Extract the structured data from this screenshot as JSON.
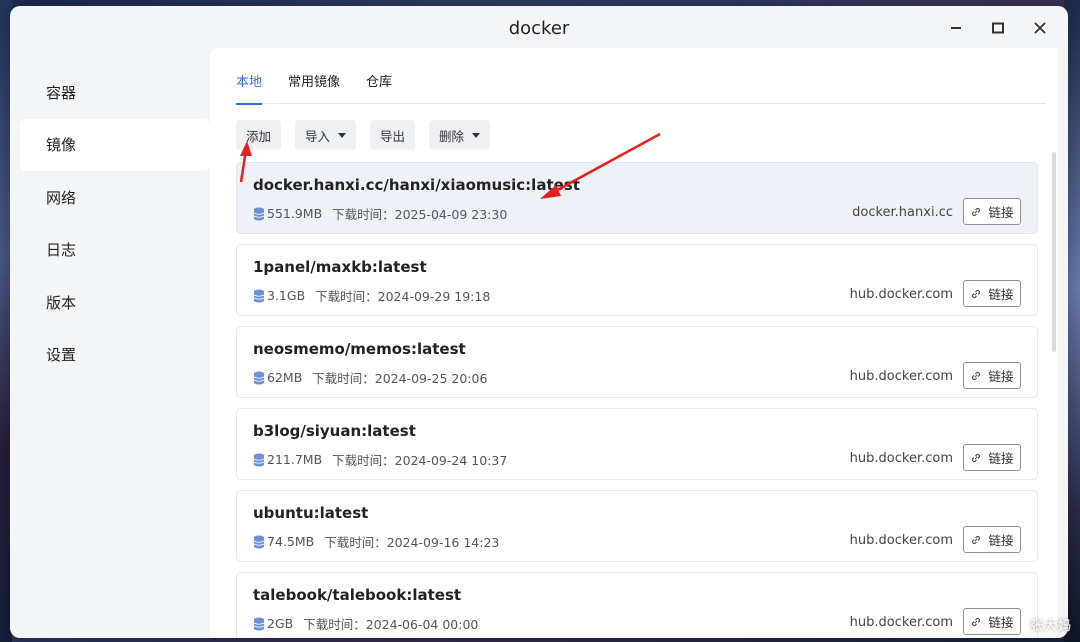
{
  "window": {
    "title": "docker"
  },
  "sidebar": {
    "items": [
      {
        "label": "容器"
      },
      {
        "label": "镜像"
      },
      {
        "label": "网络"
      },
      {
        "label": "日志"
      },
      {
        "label": "版本"
      },
      {
        "label": "设置"
      }
    ]
  },
  "tabs": [
    {
      "label": "本地"
    },
    {
      "label": "常用镜像"
    },
    {
      "label": "仓库"
    }
  ],
  "toolbar": {
    "add_label": "添加",
    "import_label": "导入",
    "export_label": "导出",
    "delete_label": "删除"
  },
  "images": [
    {
      "name": "docker.hanxi.cc/hanxi/xiaomusic:latest",
      "size": "551.9MB",
      "download_time": "下载时间：2025-04-09 23:30",
      "source": "docker.hanxi.cc",
      "link_label": "链接"
    },
    {
      "name": "1panel/maxkb:latest",
      "size": "3.1GB",
      "download_time": "下载时间：2024-09-29 19:18",
      "source": "hub.docker.com",
      "link_label": "链接"
    },
    {
      "name": "neosmemo/memos:latest",
      "size": "62MB",
      "download_time": "下载时间：2024-09-25 20:06",
      "source": "hub.docker.com",
      "link_label": "链接"
    },
    {
      "name": "b3log/siyuan:latest",
      "size": "211.7MB",
      "download_time": "下载时间：2024-09-24 10:37",
      "source": "hub.docker.com",
      "link_label": "链接"
    },
    {
      "name": "ubuntu:latest",
      "size": "74.5MB",
      "download_time": "下载时间：2024-09-16 14:23",
      "source": "hub.docker.com",
      "link_label": "链接"
    },
    {
      "name": "talebook/talebook:latest",
      "size": "2GB",
      "download_time": "下载时间：2024-06-04 00:00",
      "source": "hub.docker.com",
      "link_label": "链接"
    }
  ],
  "colors": {
    "accent": "#2f6fe4",
    "annotation_arrow": "#e8201c"
  },
  "watermark": {
    "text": "张大妈"
  }
}
